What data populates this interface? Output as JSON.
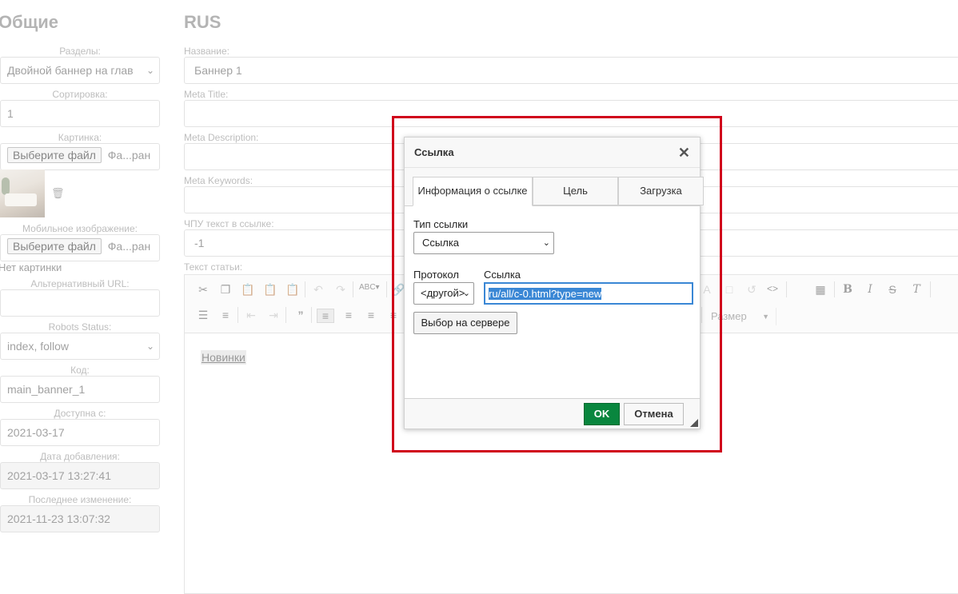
{
  "left": {
    "title": "Общие",
    "sections_label": "Разделы:",
    "sections_value": "Двойной баннер на глав",
    "sort_label": "Сортировка:",
    "sort_value": "1",
    "image_label": "Картинка:",
    "file_button": "Выберите файл",
    "file_status": "Фа...ран",
    "mobile_label": "Мобильное изображение:",
    "mobile_file_button": "Выберите файл",
    "mobile_file_status": "Фа...ран",
    "no_image": "Нет картинки",
    "alt_url_label": "Альтернативный URL:",
    "alt_url_value": "",
    "robots_label": "Robots Status:",
    "robots_value": "index, follow",
    "code_label": "Код:",
    "code_value": "main_banner_1",
    "available_label": "Доступна с:",
    "available_value": "2021-03-17",
    "added_label": "Дата добавления:",
    "added_value": "2021-03-17 13:27:41",
    "modified_label": "Последнее изменение:",
    "modified_value": "2021-11-23 13:07:32"
  },
  "right": {
    "title": "RUS",
    "name_label": "Название:",
    "name_value": "Баннер 1",
    "meta_title_label": "Meta Title:",
    "meta_desc_label": "Meta Description:",
    "meta_keywords_label": "Meta Keywords:",
    "slug_label": "ЧПУ текст в ссылке:",
    "slug_value": "-1",
    "article_label": "Текст статьи:",
    "size_combo": "Размер",
    "editor_content": "Новинки"
  },
  "dialog": {
    "title": "Ссылка",
    "tabs": [
      "Информация о ссылке",
      "Цель",
      "Загрузка"
    ],
    "link_type_label": "Тип ссылки",
    "link_type_value": "Ссылка",
    "protocol_label": "Протокол",
    "protocol_value": "<другой>",
    "url_label": "Ссылка",
    "url_value": "ru/all/c-0.html?type=new",
    "browse_server": "Выбор на сервере",
    "ok": "OK",
    "cancel": "Отмена"
  },
  "colors": {
    "highlight_frame": "#d0021b",
    "ok_button": "#09863e",
    "selection": "#3a87d5"
  }
}
